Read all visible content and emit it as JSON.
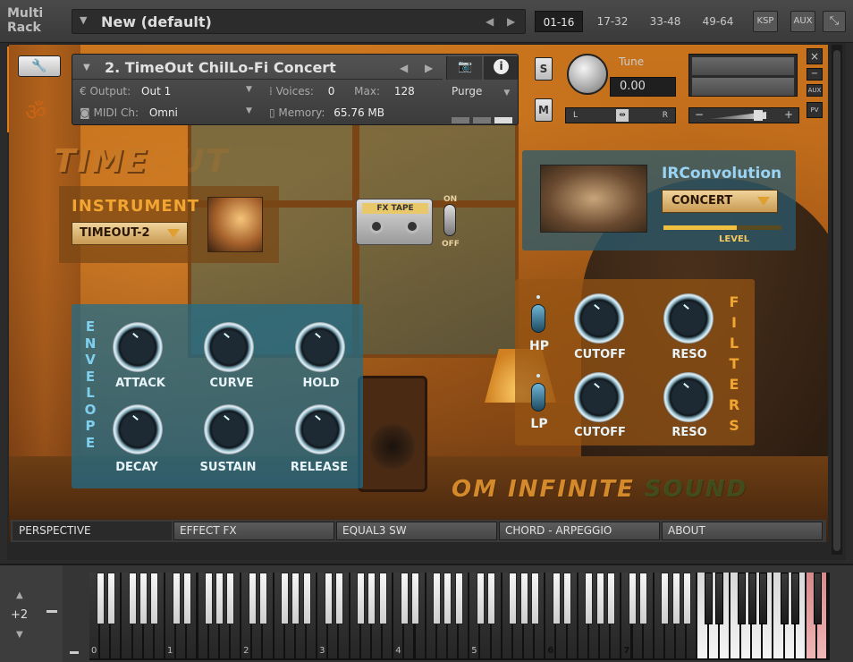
{
  "top_bar": {
    "multi_rack_line1": "Multi",
    "multi_rack_line2": "Rack",
    "preset_name": "New (default)",
    "rack_tabs": [
      "01-16",
      "17-32",
      "33-48",
      "49-64"
    ],
    "ksp_label": "KSP",
    "aux_label": "AUX"
  },
  "instrument_header": {
    "title": "2. TimeOut ChilLo-Fi Concert",
    "output_label": "Output:",
    "output_value": "Out 1",
    "voices_label": "Voices:",
    "voices_value": "0",
    "max_label": "Max:",
    "max_value": "128",
    "purge_label": "Purge",
    "midi_label": "MIDI Ch:",
    "midi_value": "Omni",
    "memory_label": "Memory:",
    "memory_value": "65.76 MB",
    "info_label": "i",
    "solo_label": "S",
    "mute_label": "M",
    "tune_label": "Tune",
    "tune_value": "0.00",
    "pan_left": "L",
    "pan_right": "R",
    "vol_minus": "−",
    "vol_plus": "+",
    "aux_small": "AUX",
    "pv_small": "PV",
    "close_symbol": "×",
    "minimize_symbol": "−"
  },
  "skin": {
    "logo_timeout_main": "TIME",
    "logo_timeout_dim": "OUT",
    "logo_om_main": "OM INFINITE ",
    "logo_om_dim": "SOUND",
    "om_symbol": "ॐ"
  },
  "instrument_select": {
    "title": "INSTRUMENT",
    "value": "TIMEOUT-2"
  },
  "fx_tape": {
    "label": "FX TAPE",
    "on_label": "ON",
    "off_label": "OFF"
  },
  "ir_convolution": {
    "title": "IRConvolution",
    "value": "CONCERT",
    "level_label": "LEVEL",
    "level_fraction": 0.62
  },
  "envelope": {
    "vertical_label": [
      "E",
      "N",
      "V",
      "E",
      "L",
      "O",
      "P",
      "E"
    ],
    "knobs": [
      "ATTACK",
      "CURVE",
      "HOLD",
      "DECAY",
      "SUSTAIN",
      "RELEASE"
    ]
  },
  "filters": {
    "vertical_label": [
      "F",
      "I",
      "L",
      "T",
      "E",
      "R",
      "S"
    ],
    "hp_label": "HP",
    "lp_label": "LP",
    "knobs": [
      "CUTOFF",
      "RESO",
      "CUTOFF",
      "RESO"
    ]
  },
  "bottom_tabs": [
    "PERSPECTIVE",
    "EFFECT FX",
    "EQUAL3 SW",
    "CHORD - ARPEGGIO",
    "ABOUT"
  ],
  "keyboard": {
    "octave_value": "+2",
    "octave_labels": [
      "0",
      "1",
      "2",
      "3",
      "4",
      "5",
      "6",
      "7"
    ],
    "up_symbol": "▲",
    "down_symbol": "▼"
  }
}
